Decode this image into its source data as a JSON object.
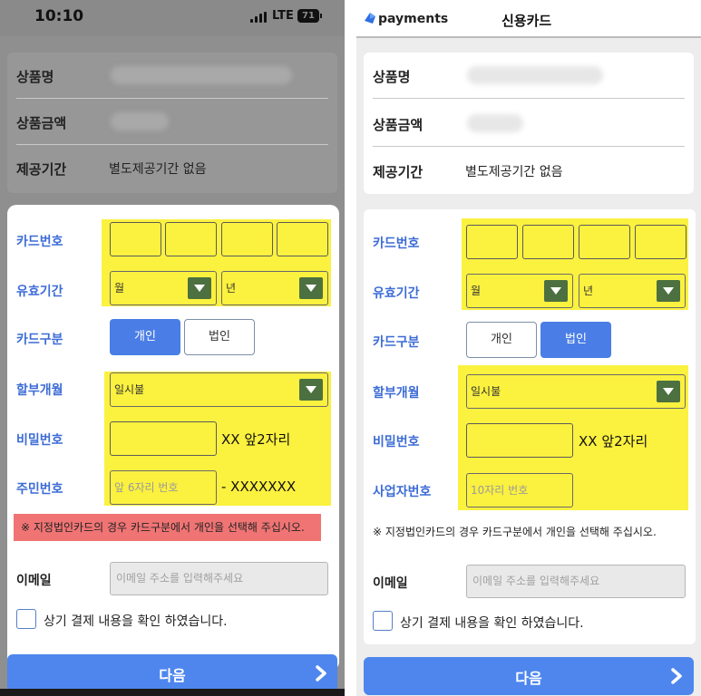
{
  "left": {
    "status": {
      "time": "10:10",
      "network": "LTE",
      "battery": "71"
    },
    "info": [
      {
        "label": "상품명",
        "value": ""
      },
      {
        "label": "상품금액",
        "value": ""
      },
      {
        "label": "제공기간",
        "value": "별도제공기간 없음"
      }
    ],
    "form": {
      "card_number_label": "카드번호",
      "expiry_label": "유효기간",
      "expiry_month": "월",
      "expiry_year": "년",
      "card_type_label": "카드구분",
      "card_type_personal": "개인",
      "card_type_corporate": "법인",
      "card_type_selected": "개인",
      "installment_label": "할부개월",
      "installment_value": "일시불",
      "password_label": "비밀번호",
      "password_suffix": "XX 앞2자리",
      "id_label": "주민번호",
      "id_placeholder": "앞 6자리 번호",
      "id_suffix": "- XXXXXXX",
      "notice": "※ 지정법인카드의 경우 카드구분에서 개인을 선택해 주십시오.",
      "email_label": "이메일",
      "email_placeholder": "이메일 주소를 입력해주세요",
      "confirm_text": "상기 결제 내용을 확인 하였습니다."
    },
    "next_label": "다음"
  },
  "right": {
    "header": {
      "brand": "payments",
      "title": "신용카드"
    },
    "info": [
      {
        "label": "상품명",
        "value": ""
      },
      {
        "label": "상품금액",
        "value": ""
      },
      {
        "label": "제공기간",
        "value": "별도제공기간 없음"
      }
    ],
    "form": {
      "card_number_label": "카드번호",
      "expiry_label": "유효기간",
      "expiry_month": "월",
      "expiry_year": "년",
      "card_type_label": "카드구분",
      "card_type_personal": "개인",
      "card_type_corporate": "법인",
      "card_type_selected": "법인",
      "installment_label": "할부개월",
      "installment_value": "일시불",
      "password_label": "비밀번호",
      "password_suffix": "XX 앞2자리",
      "biz_label": "사업자번호",
      "biz_placeholder": "10자리 번호",
      "notice": "※ 지정법인카드의 경우 카드구분에서 개인을 선택해 주십시오.",
      "email_label": "이메일",
      "email_placeholder": "이메일 주소를 입력해주세요",
      "confirm_text": "상기 결제 내용을 확인 하였습니다."
    },
    "next_label": "다음"
  },
  "colors": {
    "highlight": "#fbf13f",
    "accent_blue": "#4a7ee6",
    "label_blue": "#3d6cd6",
    "select_button": "#4d7040",
    "warning_bg": "#f07474"
  }
}
